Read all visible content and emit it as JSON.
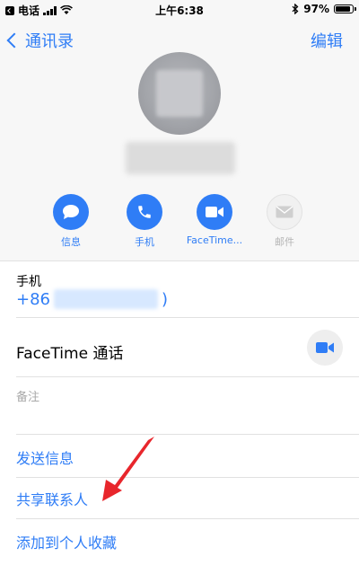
{
  "status_bar": {
    "carrier": "电话",
    "time": "上午6:38",
    "battery": "97%",
    "battery_level": 0.97
  },
  "nav": {
    "back_label": "通讯录",
    "edit_label": "编辑"
  },
  "actions": [
    {
      "label": "信息",
      "icon": "message-icon",
      "enabled": true
    },
    {
      "label": "手机",
      "icon": "phone-icon",
      "enabled": true
    },
    {
      "label": "FaceTime...",
      "icon": "video-icon",
      "enabled": true
    },
    {
      "label": "邮件",
      "icon": "mail-icon",
      "enabled": false
    }
  ],
  "details": {
    "phone_label": "手机",
    "phone_prefix": "+86",
    "phone_suffix": ")",
    "facetime_label": "FaceTime 通话",
    "notes_label": "备注"
  },
  "links": {
    "send_message": "发送信息",
    "share_contact": "共享联系人",
    "add_favorites": "添加到个人收藏"
  },
  "colors": {
    "accent": "#2f7df6",
    "annotation_arrow": "#e8262c"
  }
}
